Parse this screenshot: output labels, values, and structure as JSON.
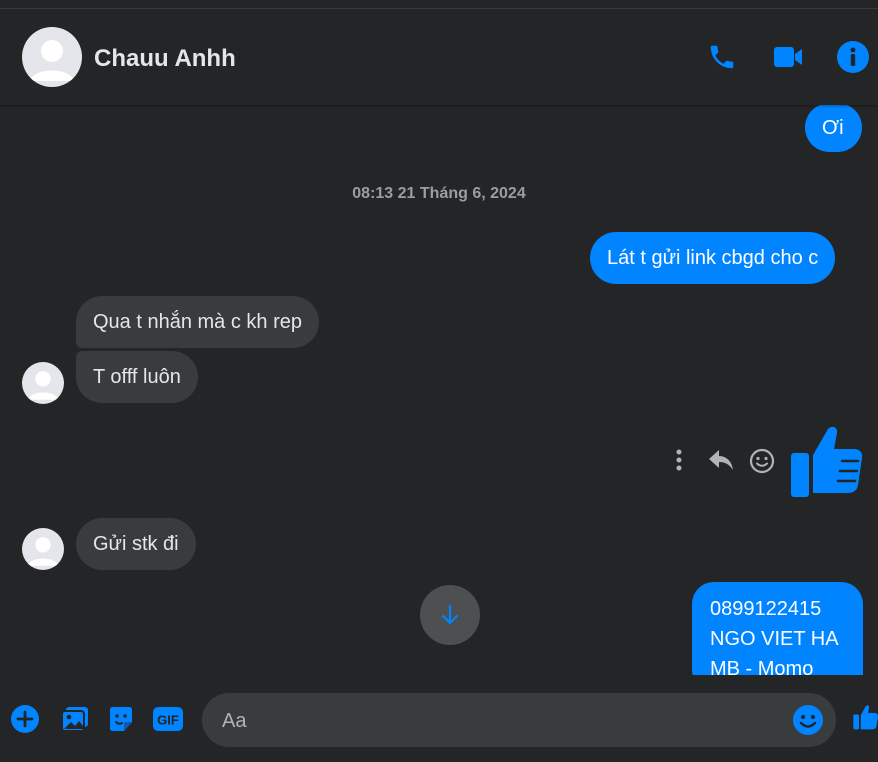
{
  "header": {
    "contact_name": "Chauu Anhh",
    "icons": [
      "phone-icon",
      "video-camera-icon",
      "info-icon"
    ]
  },
  "messages": {
    "out_1": "Ơi",
    "timestamp": "08:13 21 Tháng 6, 2024",
    "out_2": "Lát t gửi link cbgd cho c",
    "in_1": "Qua t nhắn mà c kh rep",
    "in_2": "T offf luôn",
    "in_3": "Gửi stk đi",
    "out_3": [
      "0899122415",
      "NGO VIET HA",
      "MB - Momo"
    ]
  },
  "composer": {
    "placeholder": "Aa",
    "gif_label": "GIF"
  },
  "colors": {
    "accent": "#0084ff",
    "background": "#242526",
    "incoming_bubble": "#3a3b3c"
  }
}
